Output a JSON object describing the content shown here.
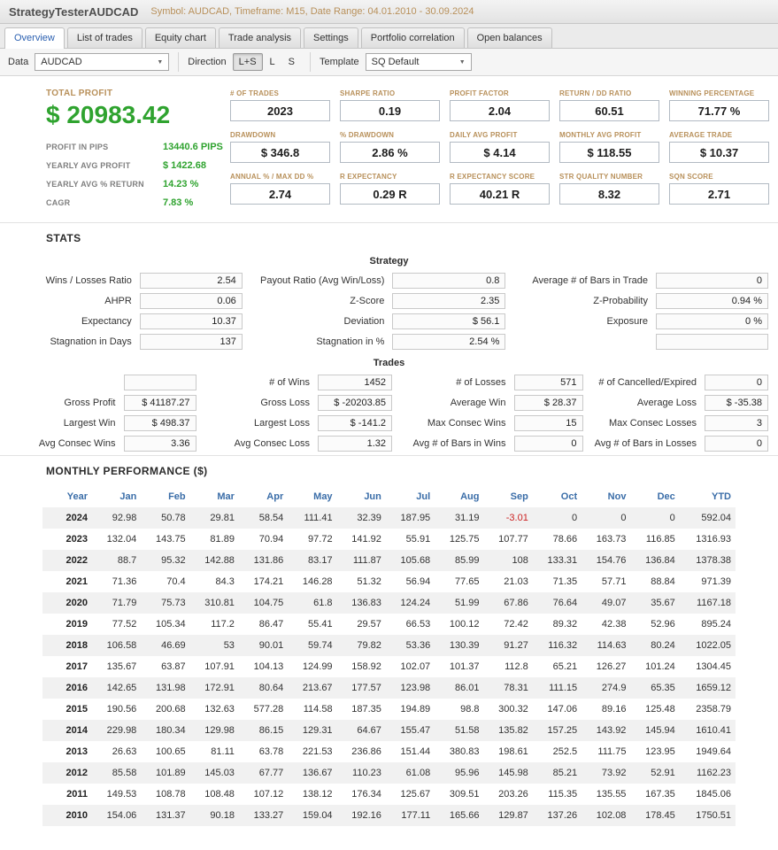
{
  "header": {
    "title": "StrategyTesterAUDCAD",
    "subtitle": "Symbol: AUDCAD, Timeframe: M15, Date Range: 04.01.2010 - 30.09.2024"
  },
  "tabs": [
    "Overview",
    "List of trades",
    "Equity chart",
    "Trade analysis",
    "Settings",
    "Portfolio correlation",
    "Open balances"
  ],
  "active_tab": "Overview",
  "toolbar": {
    "data_label": "Data",
    "data_value": "AUDCAD",
    "direction_label": "Direction",
    "direction_options": [
      "L+S",
      "L",
      "S"
    ],
    "direction_selected": "L+S",
    "template_label": "Template",
    "template_value": "SQ Default"
  },
  "icons": {
    "chevron_down": "▼"
  },
  "summary": {
    "total_profit_label": "TOTAL PROFIT",
    "total_profit_value": "$ 20983.42",
    "metrics": [
      {
        "label": "PROFIT IN PIPS",
        "value": "13440.6 PIPS"
      },
      {
        "label": "YEARLY AVG PROFIT",
        "value": "$ 1422.68"
      },
      {
        "label": "YEARLY AVG % RETURN",
        "value": "14.23 %"
      },
      {
        "label": "CAGR",
        "value": "7.83 %"
      }
    ],
    "stat_boxes": [
      {
        "label": "# OF TRADES",
        "value": "2023"
      },
      {
        "label": "SHARPE RATIO",
        "value": "0.19"
      },
      {
        "label": "PROFIT FACTOR",
        "value": "2.04"
      },
      {
        "label": "RETURN / DD RATIO",
        "value": "60.51"
      },
      {
        "label": "WINNING PERCENTAGE",
        "value": "71.77 %"
      },
      {
        "label": "DRAWDOWN",
        "value": "$ 346.8"
      },
      {
        "label": "% DRAWDOWN",
        "value": "2.86 %"
      },
      {
        "label": "DAILY AVG PROFIT",
        "value": "$ 4.14"
      },
      {
        "label": "MONTHLY AVG PROFIT",
        "value": "$ 118.55"
      },
      {
        "label": "AVERAGE TRADE",
        "value": "$ 10.37"
      },
      {
        "label": "ANNUAL % / MAX DD %",
        "value": "2.74"
      },
      {
        "label": "R EXPECTANCY",
        "value": "0.29 R"
      },
      {
        "label": "R EXPECTANCY SCORE",
        "value": "40.21 R"
      },
      {
        "label": "STR QUALITY NUMBER",
        "value": "8.32"
      },
      {
        "label": "SQN SCORE",
        "value": "2.71"
      }
    ]
  },
  "stats": {
    "heading": "STATS",
    "strategy": {
      "title": "Strategy",
      "rows": [
        [
          {
            "label": "Wins / Losses Ratio",
            "value": "2.54"
          },
          {
            "label": "Payout Ratio (Avg Win/Loss)",
            "value": "0.8"
          },
          {
            "label": "Average # of Bars in Trade",
            "value": "0"
          }
        ],
        [
          {
            "label": "AHPR",
            "value": "0.06"
          },
          {
            "label": "Z-Score",
            "value": "2.35"
          },
          {
            "label": "Z-Probability",
            "value": "0.94 %"
          }
        ],
        [
          {
            "label": "Expectancy",
            "value": "10.37"
          },
          {
            "label": "Deviation",
            "value": "$ 56.1"
          },
          {
            "label": "Exposure",
            "value": "0 %"
          }
        ],
        [
          {
            "label": "Stagnation in Days",
            "value": "137"
          },
          {
            "label": "Stagnation in %",
            "value": "2.54 %"
          },
          {
            "label": "",
            "value": ""
          }
        ]
      ]
    },
    "trades": {
      "title": "Trades",
      "rows": [
        [
          {
            "label": "",
            "value": ""
          },
          {
            "label": "# of Wins",
            "value": "1452"
          },
          {
            "label": "# of Losses",
            "value": "571"
          },
          {
            "label": "# of Cancelled/Expired",
            "value": "0"
          }
        ],
        [
          {
            "label": "Gross Profit",
            "value": "$ 41187.27"
          },
          {
            "label": "Gross Loss",
            "value": "$ -20203.85"
          },
          {
            "label": "Average Win",
            "value": "$ 28.37"
          },
          {
            "label": "Average Loss",
            "value": "$ -35.38"
          }
        ],
        [
          {
            "label": "Largest Win",
            "value": "$ 498.37"
          },
          {
            "label": "Largest Loss",
            "value": "$ -141.2"
          },
          {
            "label": "Max Consec Wins",
            "value": "15"
          },
          {
            "label": "Max Consec Losses",
            "value": "3"
          }
        ],
        [
          {
            "label": "Avg Consec Wins",
            "value": "3.36"
          },
          {
            "label": "Avg Consec Loss",
            "value": "1.32"
          },
          {
            "label": "Avg # of Bars in Wins",
            "value": "0"
          },
          {
            "label": "Avg # of Bars in Losses",
            "value": "0"
          }
        ]
      ]
    }
  },
  "monthly": {
    "heading": "MONTHLY PERFORMANCE ($)",
    "columns": [
      "Year",
      "Jan",
      "Feb",
      "Mar",
      "Apr",
      "May",
      "Jun",
      "Jul",
      "Aug",
      "Sep",
      "Oct",
      "Nov",
      "Dec",
      "YTD"
    ],
    "rows": [
      {
        "year": "2024",
        "values": [
          "92.98",
          "50.78",
          "29.81",
          "58.54",
          "111.41",
          "32.39",
          "187.95",
          "31.19",
          "-3.01",
          "0",
          "0",
          "0",
          "592.04"
        ]
      },
      {
        "year": "2023",
        "values": [
          "132.04",
          "143.75",
          "81.89",
          "70.94",
          "97.72",
          "141.92",
          "55.91",
          "125.75",
          "107.77",
          "78.66",
          "163.73",
          "116.85",
          "1316.93"
        ]
      },
      {
        "year": "2022",
        "values": [
          "88.7",
          "95.32",
          "142.88",
          "131.86",
          "83.17",
          "111.87",
          "105.68",
          "85.99",
          "108",
          "133.31",
          "154.76",
          "136.84",
          "1378.38"
        ]
      },
      {
        "year": "2021",
        "values": [
          "71.36",
          "70.4",
          "84.3",
          "174.21",
          "146.28",
          "51.32",
          "56.94",
          "77.65",
          "21.03",
          "71.35",
          "57.71",
          "88.84",
          "971.39"
        ]
      },
      {
        "year": "2020",
        "values": [
          "71.79",
          "75.73",
          "310.81",
          "104.75",
          "61.8",
          "136.83",
          "124.24",
          "51.99",
          "67.86",
          "76.64",
          "49.07",
          "35.67",
          "1167.18"
        ]
      },
      {
        "year": "2019",
        "values": [
          "77.52",
          "105.34",
          "117.2",
          "86.47",
          "55.41",
          "29.57",
          "66.53",
          "100.12",
          "72.42",
          "89.32",
          "42.38",
          "52.96",
          "895.24"
        ]
      },
      {
        "year": "2018",
        "values": [
          "106.58",
          "46.69",
          "53",
          "90.01",
          "59.74",
          "79.82",
          "53.36",
          "130.39",
          "91.27",
          "116.32",
          "114.63",
          "80.24",
          "1022.05"
        ]
      },
      {
        "year": "2017",
        "values": [
          "135.67",
          "63.87",
          "107.91",
          "104.13",
          "124.99",
          "158.92",
          "102.07",
          "101.37",
          "112.8",
          "65.21",
          "126.27",
          "101.24",
          "1304.45"
        ]
      },
      {
        "year": "2016",
        "values": [
          "142.65",
          "131.98",
          "172.91",
          "80.64",
          "213.67",
          "177.57",
          "123.98",
          "86.01",
          "78.31",
          "111.15",
          "274.9",
          "65.35",
          "1659.12"
        ]
      },
      {
        "year": "2015",
        "values": [
          "190.56",
          "200.68",
          "132.63",
          "577.28",
          "114.58",
          "187.35",
          "194.89",
          "98.8",
          "300.32",
          "147.06",
          "89.16",
          "125.48",
          "2358.79"
        ]
      },
      {
        "year": "2014",
        "values": [
          "229.98",
          "180.34",
          "129.98",
          "86.15",
          "129.31",
          "64.67",
          "155.47",
          "51.58",
          "135.82",
          "157.25",
          "143.92",
          "145.94",
          "1610.41"
        ]
      },
      {
        "year": "2013",
        "values": [
          "26.63",
          "100.65",
          "81.11",
          "63.78",
          "221.53",
          "236.86",
          "151.44",
          "380.83",
          "198.61",
          "252.5",
          "111.75",
          "123.95",
          "1949.64"
        ]
      },
      {
        "year": "2012",
        "values": [
          "85.58",
          "101.89",
          "145.03",
          "67.77",
          "136.67",
          "110.23",
          "61.08",
          "95.96",
          "145.98",
          "85.21",
          "73.92",
          "52.91",
          "1162.23"
        ]
      },
      {
        "year": "2011",
        "values": [
          "149.53",
          "108.78",
          "108.48",
          "107.12",
          "138.12",
          "176.34",
          "125.67",
          "309.51",
          "203.26",
          "115.35",
          "135.55",
          "167.35",
          "1845.06"
        ]
      },
      {
        "year": "2010",
        "values": [
          "154.06",
          "131.37",
          "90.18",
          "133.27",
          "159.04",
          "192.16",
          "177.11",
          "165.66",
          "129.87",
          "137.26",
          "102.08",
          "178.45",
          "1750.51"
        ]
      }
    ]
  },
  "colors": {
    "profit_green": "#2fa32f",
    "accent_tan": "#b8905a",
    "link_blue": "#3a6da8",
    "negative_red": "#cc2222",
    "active_tab_blue": "#2a5fb0"
  }
}
